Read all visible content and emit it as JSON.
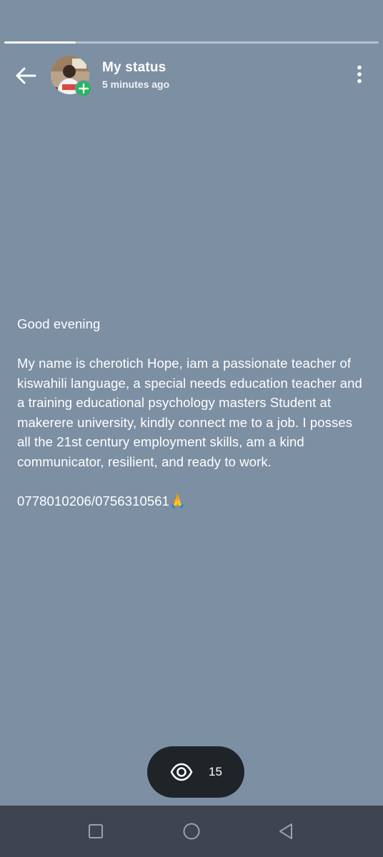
{
  "status_progress": {
    "segments": 1,
    "current_fill_fraction": 0.19
  },
  "header": {
    "title": "My status",
    "subtitle": "5 minutes ago"
  },
  "status": {
    "background_color": "#7d8fa3",
    "text": "Good evening\n\nMy name is cherotich Hope, iam a passionate teacher of kiswahili language, a special needs education teacher and a training educational psychology masters Student at makerere university, kindly connect me to a job. I posses all the 21st century employment skills, am a kind communicator, resilient, and ready to work.\n\n0778010206/0756310561🙏"
  },
  "views": {
    "icon": "eye-icon",
    "count": "15"
  },
  "icons": {
    "back": "back-arrow-icon",
    "add": "plus-icon",
    "more": "more-vert-icon",
    "nav_recents": "square-icon",
    "nav_home": "circle-icon",
    "nav_back": "triangle-back-icon"
  },
  "colors": {
    "add_badge": "#25b75e",
    "views_pill": "#1f2429",
    "nav_bar": "#3e4550"
  }
}
